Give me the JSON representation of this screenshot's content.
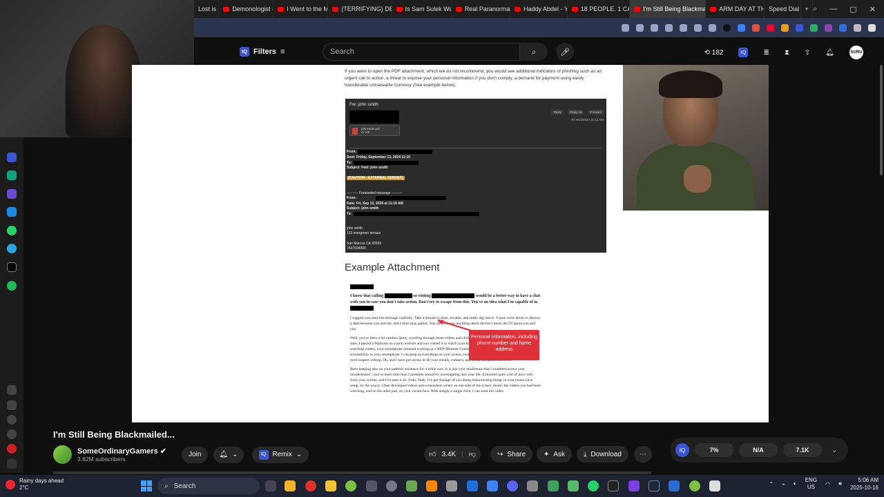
{
  "tabs": [
    {
      "label": "Lost is",
      "yt": false
    },
    {
      "label": "Demonologist -",
      "yt": true
    },
    {
      "label": "I Went to the M",
      "yt": true
    },
    {
      "label": "(TERRIFYING) DE",
      "yt": true
    },
    {
      "label": "Is Sam Sulek Wo",
      "yt": true
    },
    {
      "label": "Real Paranormal",
      "yt": true
    },
    {
      "label": "Haddy Abdel - Y",
      "yt": true
    },
    {
      "label": "18 PEOPLE. 1 CA",
      "yt": true
    },
    {
      "label": "I'm Still Being Blackmail",
      "yt": true,
      "active": true
    },
    {
      "label": "ARM DAY AT TH",
      "yt": true
    },
    {
      "label": "Speed Dial",
      "yt": false
    }
  ],
  "header": {
    "filters_label": "Filters",
    "iq_label": "IQ",
    "search_placeholder": "Search",
    "counter": "182",
    "avatar_label": "SURU"
  },
  "video": {
    "intro_text": "If you were to open the PDF attachment, which we do not recommend, you would see additional indicators of phishing such as an urgent call to action, a threat to expose your personal information if you don't comply, a demand for payment using easily transferable untraceable currency (See example below).",
    "email": {
      "subject": "Fw: john smith",
      "attachment_name": "johnsmith.pdf",
      "attachment_size": "47 KB",
      "actions": [
        "Reply",
        "Reply All",
        "Forward"
      ],
      "date": "Fri 9/13/2024 11:12 AM",
      "lines": [
        "From:",
        "Sent: Friday, September 13, 2024 11:10",
        "To:",
        "Subject: Fwd: john smith",
        "",
        "[CAUTION - EXTERNAL SENDER]",
        "",
        "---------- Forwarded message ---------",
        "From:",
        "Date: Fri, Sep 13, 2024 at 11:10 AM",
        "Subject: john smith",
        "To:",
        "",
        "john smith",
        "123 evergreen terrace",
        "",
        "San Marcos CA 92069",
        "7607504000"
      ]
    },
    "example_heading": "Example Attachment",
    "letter": {
      "p1a": "I know that calling",
      "p1b": "or visiting",
      "p1c": "would be a better way to have a chat with you in case you don't take action. Don't try to escape from this. You've no idea what I'm capable of in",
      "p2": "I suggest you read this message carefully. Take a minute to relax, breathe, and really dig into it. 'Cause we're about to discuss a deal between you and me, and I don't play games. You do not know anything about me but I know ALOT about you and you",
      "p3": "Well, you've been a bit careless lately, scrolling through those videos and clicking on links, stumbling upon some not-so-safe sites. I placed a Malware on a porn website and you visited it to watch (you know what I mean?). When you were busy watching videos, your smartphone initiated working as a RDP (Remote Control) which provided me with complete accessibility to your smartphone. I can peep at everything on your screen, switch on your cam and mic, and you wouldn't even suspect a thing. Oh, and I have got access to all your emails, contacts, and social media accounts too.",
      "p4": "Been keeping tabs on your pathetic existence for a while now. It is just your misfortune that I stumbled across your misdemeanor. I put in more time than I probably should've investigating into your life. Extracted quite a bit of juicy info from your system. and I've seen it all. Yeah, Yeah, I've got footage of you doing embarrassing things in your house (nice setup, by the ways). I then developed videos and screenshots where on one side of the screen, there's the videos you had been watching, and on the other part, its your vacant face. With simply a single click, I can send this video"
    },
    "callout": "Personal Information, including phone number and home address"
  },
  "video_info": {
    "title": "I'm Still Being Blackmailed...",
    "channel": "SomeOrdinaryGamers",
    "subscribers": "3.82M subscribers",
    "join": "Join",
    "remix": "Remix",
    "likes": "3.4K",
    "share": "Share",
    "ask": "Ask",
    "download": "Download"
  },
  "stats": {
    "iq": "IQ",
    "a": "7%",
    "b": "N/A",
    "c": "7.1K"
  },
  "taskbar": {
    "weather_line1": "Rainy days ahead",
    "weather_line2": "2°C",
    "search": "Search",
    "lang1": "ENG",
    "lang2": "US",
    "time": "5:06 AM",
    "date": "2025-10-16"
  },
  "colors": {
    "youtube_red": "#ff0000",
    "callout_red": "#e0303a",
    "caution_bg": "#c79a2a",
    "ext_bar": "#2c3550"
  }
}
